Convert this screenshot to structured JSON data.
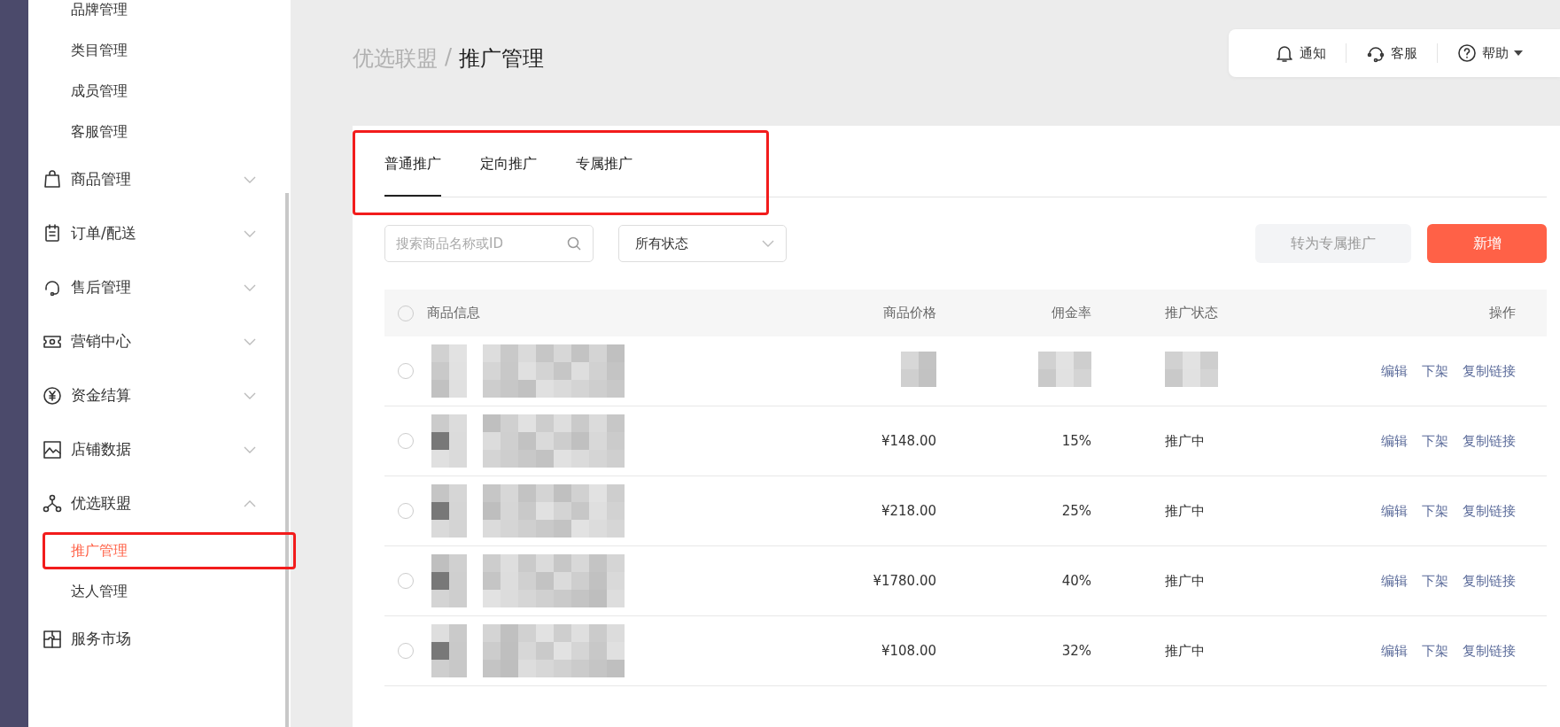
{
  "sidebar": {
    "items": [
      {
        "kind": "sub",
        "label": "品牌管理",
        "selected": false
      },
      {
        "kind": "sub",
        "label": "类目管理",
        "selected": false
      },
      {
        "kind": "sub",
        "label": "成员管理",
        "selected": false
      },
      {
        "kind": "sub",
        "label": "客服管理",
        "selected": false
      },
      {
        "kind": "group",
        "label": "商品管理",
        "expanded": false
      },
      {
        "kind": "group",
        "label": "订单/配送",
        "expanded": false
      },
      {
        "kind": "group",
        "label": "售后管理",
        "expanded": false
      },
      {
        "kind": "group",
        "label": "营销中心",
        "expanded": false
      },
      {
        "kind": "group",
        "label": "资金结算",
        "expanded": false
      },
      {
        "kind": "group",
        "label": "店铺数据",
        "expanded": false
      },
      {
        "kind": "group",
        "label": "优选联盟",
        "expanded": true,
        "children": [
          {
            "label": "推广管理",
            "selected": true,
            "framed": true
          },
          {
            "label": "达人管理",
            "selected": false,
            "framed": false
          }
        ]
      },
      {
        "kind": "link",
        "label": "服务市场"
      }
    ]
  },
  "breadcrumb": [
    "优选联盟",
    "/",
    "推广管理"
  ],
  "header_links": [
    {
      "label": "通知"
    },
    {
      "label": "客服"
    },
    {
      "label": "帮助",
      "dropdown": true
    }
  ],
  "tabs": {
    "framed": true,
    "items": [
      {
        "label": "普通推广",
        "selected": true
      },
      {
        "label": "定向推广",
        "selected": false
      },
      {
        "label": "专属推广",
        "selected": false
      }
    ]
  },
  "search": {
    "placeholder": "搜索商品名称或ID"
  },
  "status_filter": {
    "value": "所有状态"
  },
  "buttons": [
    {
      "label": "转为专属推广",
      "disabled": true
    },
    {
      "label": "新增",
      "disabled": false
    }
  ],
  "table": {
    "select_all": false,
    "columns": [
      "商品信息",
      "商品价格",
      "佣金率",
      "推广状态",
      "操作"
    ],
    "rows": [
      {
        "kind": "blurred",
        "selected": false,
        "actions": [
          "编辑",
          "下架",
          "复制链接"
        ]
      },
      {
        "kind": "plain",
        "selected": false,
        "price": "¥148.00",
        "rate": "15%",
        "status": "推广中",
        "actions": [
          "编辑",
          "下架",
          "复制链接"
        ]
      },
      {
        "kind": "plain",
        "selected": false,
        "price": "¥218.00",
        "rate": "25%",
        "status": "推广中",
        "actions": [
          "编辑",
          "下架",
          "复制链接"
        ]
      },
      {
        "kind": "plain",
        "selected": false,
        "price": "¥1780.00",
        "rate": "40%",
        "status": "推广中",
        "actions": [
          "编辑",
          "下架",
          "复制链接"
        ]
      },
      {
        "kind": "plain",
        "selected": false,
        "price": "¥108.00",
        "rate": "32%",
        "status": "推广中",
        "actions": [
          "编辑",
          "下架",
          "复制链接"
        ]
      }
    ]
  }
}
